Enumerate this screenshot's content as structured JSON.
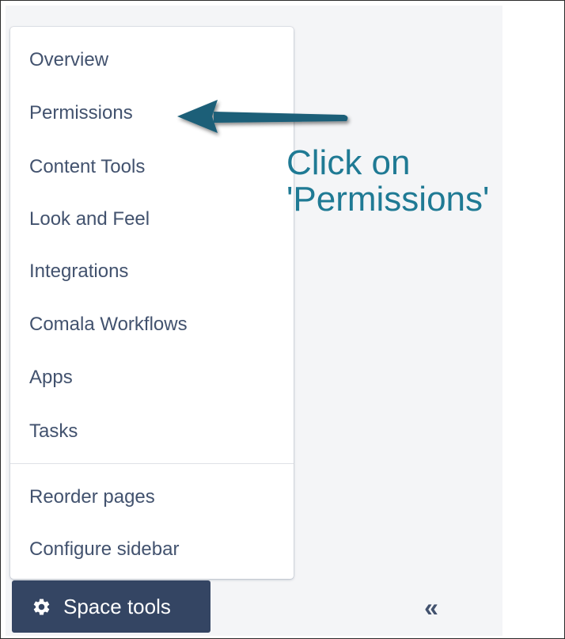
{
  "menu": {
    "items": [
      {
        "label": "Overview"
      },
      {
        "label": "Permissions"
      },
      {
        "label": "Content Tools"
      },
      {
        "label": "Look and Feel"
      },
      {
        "label": "Integrations"
      },
      {
        "label": "Comala Workflows"
      },
      {
        "label": "Apps"
      },
      {
        "label": "Tasks"
      }
    ],
    "extra_items": [
      {
        "label": "Reorder pages"
      },
      {
        "label": "Configure sidebar"
      }
    ]
  },
  "annotation": {
    "line1": "Click on",
    "line2": "'Permissions'",
    "color": "#1f7a94"
  },
  "footer": {
    "space_tools_label": "Space tools",
    "collapse_symbol": "«",
    "button_color": "#344563"
  },
  "icons": {
    "space_tools": "gear-icon",
    "collapse": "double-chevron-left-icon",
    "arrow": "arrow-left-icon"
  }
}
